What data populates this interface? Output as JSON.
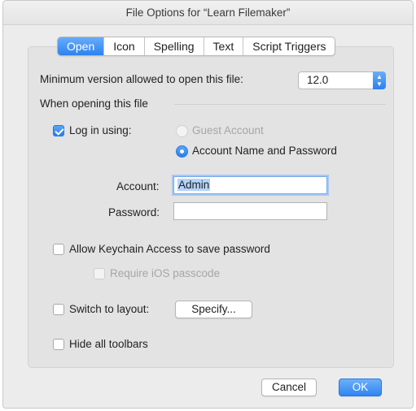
{
  "window": {
    "title": "File Options for “Learn Filemaker”"
  },
  "tabs": [
    {
      "label": "Open",
      "active": true
    },
    {
      "label": "Icon",
      "active": false
    },
    {
      "label": "Spelling",
      "active": false
    },
    {
      "label": "Text",
      "active": false
    },
    {
      "label": "Script Triggers",
      "active": false
    }
  ],
  "open": {
    "min_version_label": "Minimum version allowed to open this file:",
    "min_version_value": "12.0",
    "section_label": "When opening this file",
    "login_checkbox_label": "Log in using:",
    "login_checked": true,
    "radio_guest_label": "Guest Account",
    "radio_account_label": "Account Name and Password",
    "account_label": "Account:",
    "account_value": "Admin",
    "password_label": "Password:",
    "password_value": "",
    "keychain_label": "Allow Keychain Access to save password",
    "ios_passcode_label": "Require iOS passcode",
    "switch_layout_label": "Switch to layout:",
    "specify_button": "Specify...",
    "hide_toolbars_label": "Hide all toolbars"
  },
  "footer": {
    "cancel_label": "Cancel",
    "ok_label": "OK"
  },
  "colors": {
    "accent": "#3b8ef3",
    "panel": "#e3e3e3",
    "window": "#ececec"
  }
}
